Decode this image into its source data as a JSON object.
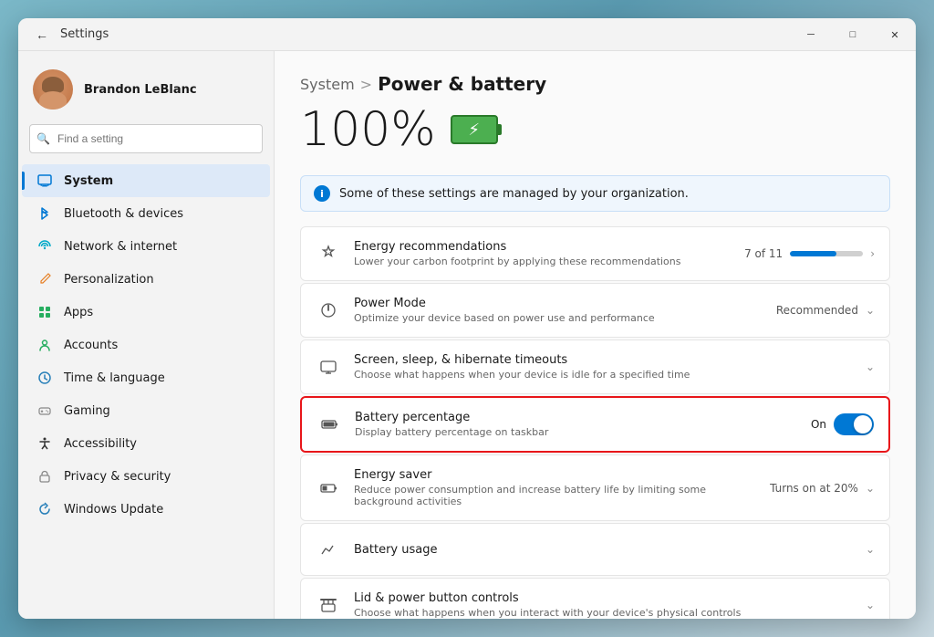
{
  "window": {
    "title": "Settings",
    "back_label": "←",
    "minimize_label": "─",
    "maximize_label": "□",
    "close_label": "✕"
  },
  "sidebar": {
    "user": {
      "name": "Brandon LeBlanc"
    },
    "search": {
      "placeholder": "Find a setting"
    },
    "nav": [
      {
        "id": "system",
        "label": "System",
        "icon": "🖥",
        "active": true
      },
      {
        "id": "bluetooth",
        "label": "Bluetooth & devices",
        "icon": "✦",
        "active": false
      },
      {
        "id": "network",
        "label": "Network & internet",
        "icon": "🌐",
        "active": false
      },
      {
        "id": "personalization",
        "label": "Personalization",
        "icon": "✏",
        "active": false
      },
      {
        "id": "apps",
        "label": "Apps",
        "icon": "≡",
        "active": false
      },
      {
        "id": "accounts",
        "label": "Accounts",
        "icon": "👤",
        "active": false
      },
      {
        "id": "time",
        "label": "Time & language",
        "icon": "🌍",
        "active": false
      },
      {
        "id": "gaming",
        "label": "Gaming",
        "icon": "⚙",
        "active": false
      },
      {
        "id": "accessibility",
        "label": "Accessibility",
        "icon": "♿",
        "active": false
      },
      {
        "id": "privacy",
        "label": "Privacy & security",
        "icon": "🔒",
        "active": false
      },
      {
        "id": "update",
        "label": "Windows Update",
        "icon": "↻",
        "active": false
      }
    ]
  },
  "main": {
    "breadcrumb_parent": "System",
    "breadcrumb_separator": ">",
    "breadcrumb_current": "Power & battery",
    "battery_percent": "100%",
    "info_banner": "Some of these settings are managed by your organization.",
    "rows": [
      {
        "id": "energy-recommendations",
        "icon": "⬡",
        "title": "Energy recommendations",
        "desc": "Lower your carbon footprint by applying these recommendations",
        "right_type": "progress",
        "right_text": "7 of 11",
        "progress_pct": 63,
        "has_chevron": true
      },
      {
        "id": "power-mode",
        "icon": "⚡",
        "title": "Power Mode",
        "desc": "Optimize your device based on power use and performance",
        "right_type": "dropdown",
        "right_text": "Recommended",
        "has_chevron": true
      },
      {
        "id": "screen-sleep",
        "icon": "💻",
        "title": "Screen, sleep, & hibernate timeouts",
        "desc": "Choose what happens when your device is idle for a specified time",
        "right_type": "chevron",
        "right_text": "",
        "has_chevron": true
      },
      {
        "id": "battery-percentage",
        "icon": "🔋",
        "title": "Battery percentage",
        "desc": "Display battery percentage on taskbar",
        "right_type": "toggle",
        "toggle_label": "On",
        "toggle_on": true,
        "highlighted": true
      },
      {
        "id": "energy-saver",
        "icon": "🔋",
        "title": "Energy saver",
        "desc": "Reduce power consumption and increase battery life by limiting some background activities",
        "right_type": "dropdown",
        "right_text": "Turns on at 20%",
        "has_chevron": true
      },
      {
        "id": "battery-usage",
        "icon": "📊",
        "title": "Battery usage",
        "desc": "",
        "right_type": "chevron",
        "right_text": "",
        "has_chevron": true
      },
      {
        "id": "lid-power",
        "icon": "⬛",
        "title": "Lid & power button controls",
        "desc": "Choose what happens when you interact with your device's physical controls",
        "right_type": "chevron",
        "right_text": "",
        "has_chevron": true
      }
    ]
  }
}
